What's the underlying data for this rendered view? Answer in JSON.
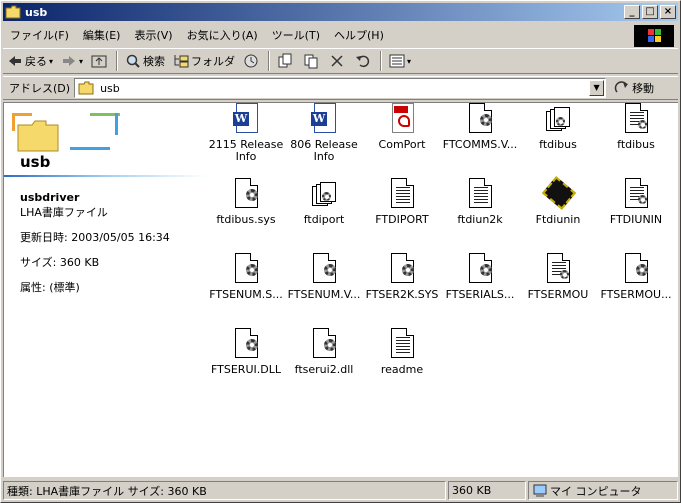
{
  "window": {
    "title": "usb"
  },
  "menu": [
    "ファイル(F)",
    "編集(E)",
    "表示(V)",
    "お気に入り(A)",
    "ツール(T)",
    "ヘルプ(H)"
  ],
  "toolbar": {
    "back": "戻る",
    "search": "検索",
    "folders": "フォルダ"
  },
  "address": {
    "label": "アドレス(D)",
    "value": "usb",
    "go": "移動"
  },
  "panel": {
    "title": "usb",
    "item_name": "usbdriver",
    "item_type": "LHA書庫ファイル",
    "modified": "更新日時: 2003/05/05 16:34",
    "size": "サイズ: 360 KB",
    "attributes": "属性: (標準)"
  },
  "files": [
    {
      "label": "2115 Release\nInfo",
      "icon": "word-doc-icon"
    },
    {
      "label": "806 Release\nInfo",
      "icon": "word-doc-icon"
    },
    {
      "label": "ComPort",
      "icon": "pdf-icon"
    },
    {
      "label": "FTCOMMS.V...",
      "icon": "system-file-icon"
    },
    {
      "label": "ftdibus",
      "icon": "setup-stack-icon"
    },
    {
      "label": "ftdibus",
      "icon": "config-file-icon"
    },
    {
      "label": "ftdibus.sys",
      "icon": "system-file-icon"
    },
    {
      "label": "ftdiport",
      "icon": "setup-stack-icon"
    },
    {
      "label": "FTDIPORT",
      "icon": "text-file-icon"
    },
    {
      "label": "ftdiun2k",
      "icon": "text-file-icon"
    },
    {
      "label": "Ftdiunin",
      "icon": "chip-icon"
    },
    {
      "label": "FTDIUNIN",
      "icon": "config-file-icon"
    },
    {
      "label": "FTSENUM.S...",
      "icon": "system-file-icon"
    },
    {
      "label": "FTSENUM.V...",
      "icon": "system-file-icon"
    },
    {
      "label": "FTSER2K.SYS",
      "icon": "system-file-icon"
    },
    {
      "label": "FTSERIALS...",
      "icon": "system-file-icon"
    },
    {
      "label": "FTSERMOU",
      "icon": "config-file-icon"
    },
    {
      "label": "FTSERMOU...",
      "icon": "system-file-icon"
    },
    {
      "label": "FTSERUI.DLL",
      "icon": "system-file-icon"
    },
    {
      "label": "ftserui2.dll",
      "icon": "system-file-icon"
    },
    {
      "label": "readme",
      "icon": "text-file-icon"
    }
  ],
  "status": {
    "type": "種類: LHA書庫ファイル サイズ: 360 KB",
    "size": "360 KB",
    "zone": "マイ コンピュータ"
  }
}
